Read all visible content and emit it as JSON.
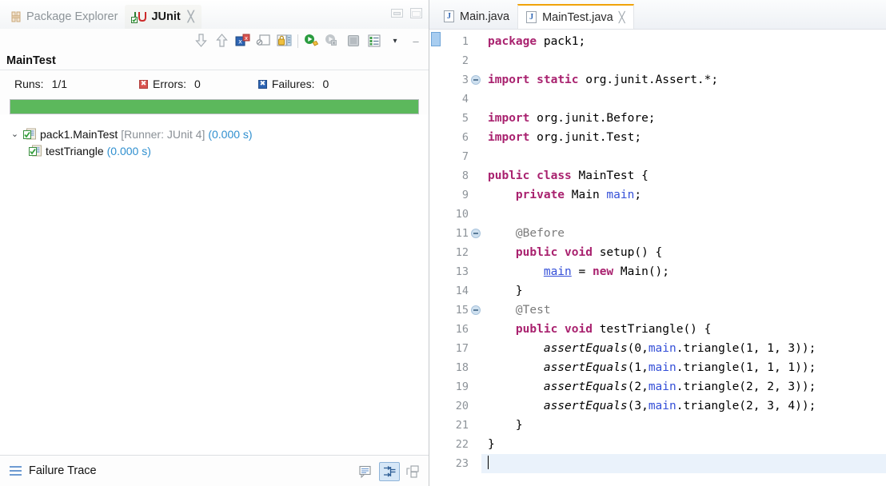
{
  "junit_view": {
    "tabs": [
      {
        "label": "Package Explorer",
        "icon": "package-explorer-icon",
        "active": false,
        "closable": false
      },
      {
        "label": "JUnit",
        "icon": "junit-icon",
        "active": true,
        "closable": true,
        "close_glyph": "╳"
      }
    ],
    "window_buttons": [
      {
        "name": "minimize-view-button",
        "tooltip": "Minimize"
      },
      {
        "name": "maximize-view-button",
        "tooltip": "Maximize"
      }
    ],
    "toolbar": [
      {
        "name": "next-failed-test-button",
        "icon": "arrow-down-icon"
      },
      {
        "name": "previous-failed-test-button",
        "icon": "arrow-up-icon"
      },
      {
        "name": "show-failures-only-button",
        "icon": "failures-only-icon"
      },
      {
        "name": "scroll-lock-button",
        "icon": "scroll-lock-icon"
      },
      {
        "name": "test-history-button",
        "icon": "history-lock-icon"
      },
      {
        "name": "rerun-test-button",
        "icon": "run-green-icon"
      },
      {
        "name": "rerun-failed-tests-button",
        "icon": "rerun-failed-icon"
      },
      {
        "name": "stop-test-run-button",
        "icon": "stop-icon"
      },
      {
        "name": "test-run-history-button",
        "icon": "list-icon"
      },
      {
        "name": "view-menu-button",
        "icon": "chevron-down-icon",
        "glyph": "▾"
      },
      {
        "name": "minimize-toolbar-button",
        "icon": "minimize-icon",
        "glyph": "–"
      }
    ],
    "test_class_header": "MainTest",
    "counters": {
      "runs_label": "Runs:",
      "runs_value": "1/1",
      "errors_label": "Errors:",
      "errors_value": "0",
      "errors_badge_glyph": "✖",
      "failures_label": "Failures:",
      "failures_value": "0",
      "failures_badge_glyph": "✖"
    },
    "progress": {
      "percent": 100,
      "color": "#5cb85c",
      "state": "pass"
    },
    "tree": [
      {
        "name": "tree-item-test-class",
        "twisty": "⌄",
        "expanded": true,
        "icon": "test-class-pass-icon",
        "label": "pack1.MainTest",
        "runner": "[Runner: JUnit 4]",
        "time": "(0.000 s)",
        "level": 0
      },
      {
        "name": "tree-item-test-method",
        "twisty": "",
        "expanded": false,
        "icon": "test-method-pass-icon",
        "label": "testTriangle",
        "runner": "",
        "time": "(0.000 s)",
        "level": 1
      }
    ],
    "failure_trace": {
      "icon": "failure-trace-icon",
      "label": "Failure Trace",
      "buttons": [
        {
          "name": "compare-result-button",
          "icon": "compare-result-icon"
        },
        {
          "name": "stack-trace-filter-button",
          "icon": "stack-trace-filter-icon",
          "active": true
        },
        {
          "name": "maximize-failure-trace-button",
          "icon": "restore-icon"
        }
      ]
    }
  },
  "editor": {
    "tabs": [
      {
        "label": "Main.java",
        "icon": "java-file-icon",
        "active": false,
        "closable": false
      },
      {
        "label": "MainTest.java",
        "icon": "java-file-icon",
        "active": true,
        "closable": true,
        "close_glyph": "╳"
      }
    ],
    "annotation_marker_line": 1,
    "cursor_line": 23,
    "folding_marker_lines": [
      3,
      11,
      15
    ],
    "line_numbers": [
      "1",
      "2",
      "3",
      "4",
      "5",
      "6",
      "7",
      "8",
      "9",
      "10",
      "11",
      "12",
      "13",
      "14",
      "15",
      "16",
      "17",
      "18",
      "19",
      "20",
      "21",
      "22",
      "23"
    ],
    "code_lines": [
      {
        "n": 1,
        "text": "package pack1;"
      },
      {
        "n": 2,
        "text": ""
      },
      {
        "n": 3,
        "text": "import static org.junit.Assert.*;"
      },
      {
        "n": 4,
        "text": ""
      },
      {
        "n": 5,
        "text": "import org.junit.Before;"
      },
      {
        "n": 6,
        "text": "import org.junit.Test;"
      },
      {
        "n": 7,
        "text": ""
      },
      {
        "n": 8,
        "text": "public class MainTest {"
      },
      {
        "n": 9,
        "text": "    private Main main;"
      },
      {
        "n": 10,
        "text": ""
      },
      {
        "n": 11,
        "text": "    @Before"
      },
      {
        "n": 12,
        "text": "    public void setup() {"
      },
      {
        "n": 13,
        "text": "        main = new Main();"
      },
      {
        "n": 14,
        "text": "    }"
      },
      {
        "n": 15,
        "text": "    @Test"
      },
      {
        "n": 16,
        "text": "    public void testTriangle() {"
      },
      {
        "n": 17,
        "text": "        assertEquals(0,main.triangle(1, 1, 3));"
      },
      {
        "n": 18,
        "text": "        assertEquals(1,main.triangle(1, 1, 1));"
      },
      {
        "n": 19,
        "text": "        assertEquals(2,main.triangle(2, 2, 3));"
      },
      {
        "n": 20,
        "text": "        assertEquals(3,main.triangle(2, 3, 4));"
      },
      {
        "n": 21,
        "text": "    }"
      },
      {
        "n": 22,
        "text": "}"
      },
      {
        "n": 23,
        "text": ""
      }
    ]
  },
  "colors": {
    "keyword": "#a9226f",
    "field": "#3550d8",
    "annotation": "#7b7b7b",
    "pass_green": "#5cb85c",
    "error_red": "#d9534f",
    "failure_blue": "#2d64b3",
    "time_blue": "#2f8fcf",
    "active_tab_accent": "#f0a30a"
  }
}
